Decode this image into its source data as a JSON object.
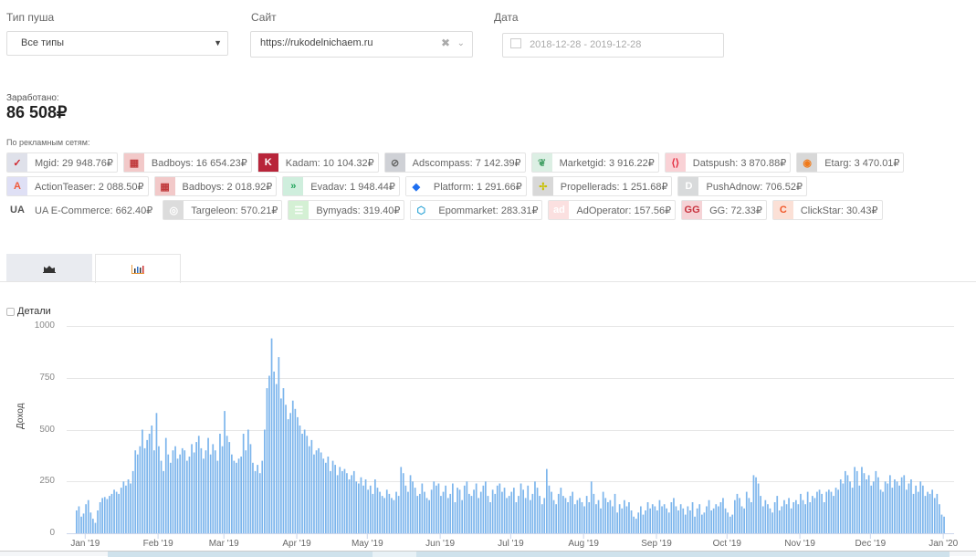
{
  "filters": {
    "push_type": {
      "label": "Тип пуша",
      "value": "Все типы"
    },
    "site": {
      "label": "Сайт",
      "value": "https://rukodelnichaem.ru"
    },
    "date": {
      "label": "Дата",
      "value": "2018-12-28 - 2019-12-28"
    }
  },
  "earned": {
    "label": "Заработано:",
    "value": "86 508₽"
  },
  "networks_label": "По рекламным сетям:",
  "networks": [
    {
      "name": "Mgid: 29 948.76₽",
      "icon": "✓",
      "bg": "#dfe1ea",
      "fg": "#d0262e"
    },
    {
      "name": "Badboys: 16 654.23₽",
      "icon": "▦",
      "bg": "#f2c9c9",
      "fg": "#c0393b"
    },
    {
      "name": "Kadam: 10 104.32₽",
      "icon": "K",
      "bg": "#b8253a",
      "fg": "#fff"
    },
    {
      "name": "Adscompass: 7 142.39₽",
      "icon": "⊘",
      "bg": "#cfd1d6",
      "fg": "#666"
    },
    {
      "name": "Marketgid: 3 916.22₽",
      "icon": "❦",
      "bg": "#dcefe4",
      "fg": "#4aa36b"
    },
    {
      "name": "Datspush: 3 870.88₽",
      "icon": "⟨⟩",
      "bg": "#f9d2d6",
      "fg": "#e3273b"
    },
    {
      "name": "Etarg: 3 470.01₽",
      "icon": "◉",
      "bg": "#d8d8d8",
      "fg": "#f07a1a"
    },
    {
      "name": "ActionTeaser: 2 088.50₽",
      "icon": "A",
      "bg": "#dfe0f5",
      "fg": "#f05a3a"
    },
    {
      "name": "Badboys: 2 018.92₽",
      "icon": "▦",
      "bg": "#f2c9c9",
      "fg": "#c0393b"
    },
    {
      "name": "Evadav: 1 948.44₽",
      "icon": "»",
      "bg": "#cfeedd",
      "fg": "#1fa35a"
    },
    {
      "name": "Platform: 1 291.66₽",
      "icon": "◆",
      "bg": "#fff",
      "fg": "#1e6ff0"
    },
    {
      "name": "Propellerads: 1 251.68₽",
      "icon": "✢",
      "bg": "#d8d8d8",
      "fg": "#c8c000"
    },
    {
      "name": "PushAdnow: 706.52₽",
      "icon": "D",
      "bg": "#d8dadb",
      "fg": "#fff"
    },
    {
      "name": "UA E-Commerce: 662.40₽",
      "icon": "UA",
      "bg": "#fff",
      "fg": "#555"
    },
    {
      "name": "Targeleon: 570.21₽",
      "icon": "◎",
      "bg": "#dcdcdc",
      "fg": "#fff"
    },
    {
      "name": "Bymyads: 319.40₽",
      "icon": "☰",
      "bg": "#d4f0d4",
      "fg": "#fff"
    },
    {
      "name": "Epommarket: 283.31₽",
      "icon": "⬡",
      "bg": "#fff",
      "fg": "#2aa3d6"
    },
    {
      "name": "AdOperator: 157.56₽",
      "icon": "ad",
      "bg": "#fbe0e0",
      "fg": "#fff"
    },
    {
      "name": "GG: 72.33₽",
      "icon": "GG",
      "bg": "#f5d3d6",
      "fg": "#c8343f"
    },
    {
      "name": "ClickStar: 30.43₽",
      "icon": "C",
      "bg": "#fbe0d6",
      "fg": "#f0582a"
    }
  ],
  "tabs": [
    {
      "name": "area-chart-tab",
      "icon": "area-chart-icon"
    },
    {
      "name": "bar-chart-tab",
      "icon": "bar-chart-icon"
    }
  ],
  "details_label": "Детали",
  "chart_data": {
    "type": "bar",
    "start_date": "2018-12-28",
    "ylabel": "Доход",
    "ylim": [
      0,
      1000
    ],
    "yticks": [
      "0",
      "250",
      "500",
      "750",
      "1000"
    ],
    "xticks": [
      "Jan '19",
      "Feb '19",
      "Mar '19",
      "Apr '19",
      "May '19",
      "Jun '19",
      "Jul '19",
      "Aug '19",
      "Sep '19",
      "Oct '19",
      "Nov '19",
      "Dec '19",
      "Jan '20"
    ],
    "xtick_days": [
      4,
      35,
      63,
      94,
      124,
      155,
      185,
      216,
      247,
      277,
      308,
      338,
      369
    ],
    "color": "#7cb5ec",
    "values": [
      110,
      130,
      80,
      95,
      140,
      160,
      100,
      70,
      50,
      110,
      150,
      170,
      175,
      165,
      180,
      190,
      210,
      200,
      190,
      220,
      250,
      230,
      260,
      240,
      300,
      400,
      380,
      420,
      500,
      410,
      450,
      480,
      520,
      400,
      580,
      420,
      350,
      300,
      460,
      380,
      340,
      400,
      420,
      360,
      380,
      410,
      400,
      350,
      370,
      430,
      390,
      440,
      470,
      410,
      360,
      400,
      460,
      380,
      430,
      400,
      350,
      480,
      420,
      590,
      470,
      440,
      380,
      350,
      340,
      360,
      370,
      480,
      400,
      500,
      430,
      340,
      300,
      330,
      290,
      350,
      500,
      700,
      760,
      940,
      780,
      720,
      850,
      650,
      700,
      620,
      550,
      580,
      640,
      600,
      560,
      520,
      480,
      500,
      470,
      420,
      450,
      380,
      400,
      410,
      390,
      360,
      340,
      370,
      300,
      350,
      330,
      280,
      320,
      300,
      310,
      290,
      260,
      280,
      300,
      250,
      240,
      270,
      230,
      260,
      210,
      230,
      190,
      260,
      220,
      200,
      180,
      170,
      210,
      190,
      170,
      160,
      200,
      180,
      320,
      290,
      230,
      200,
      280,
      250,
      220,
      180,
      190,
      240,
      200,
      170,
      160,
      210,
      250,
      230,
      240,
      180,
      200,
      230,
      170,
      190,
      240,
      150,
      220,
      210,
      160,
      230,
      250,
      190,
      180,
      210,
      240,
      170,
      200,
      230,
      250,
      180,
      150,
      210,
      190,
      230,
      240,
      200,
      220,
      170,
      180,
      200,
      220,
      150,
      180,
      240,
      210,
      170,
      230,
      160,
      190,
      250,
      220,
      180,
      140,
      170,
      310,
      230,
      200,
      160,
      140,
      190,
      220,
      180,
      170,
      150,
      180,
      200,
      140,
      160,
      170,
      150,
      130,
      180,
      150,
      250,
      190,
      140,
      160,
      120,
      200,
      170,
      150,
      160,
      130,
      190,
      100,
      140,
      120,
      160,
      130,
      150,
      110,
      80,
      70,
      100,
      130,
      90,
      110,
      150,
      120,
      140,
      130,
      110,
      160,
      130,
      140,
      120,
      100,
      150,
      170,
      130,
      110,
      140,
      120,
      90,
      130,
      110,
      150,
      80,
      120,
      140,
      90,
      100,
      130,
      160,
      110,
      120,
      140,
      130,
      150,
      170,
      120,
      100,
      80,
      90,
      160,
      190,
      170,
      130,
      120,
      200,
      170,
      150,
      280,
      270,
      240,
      180,
      130,
      160,
      140,
      120,
      100,
      150,
      180,
      110,
      130,
      160,
      140,
      170,
      120,
      150,
      160,
      140,
      190,
      160,
      140,
      200,
      150,
      180,
      170,
      200,
      210,
      190,
      150,
      200,
      210,
      200,
      180,
      220,
      210,
      260,
      240,
      300,
      280,
      250,
      220,
      320,
      300,
      230,
      320,
      290,
      260,
      280,
      230,
      250,
      300,
      270,
      210,
      200,
      250,
      240,
      280,
      220,
      260,
      250,
      230,
      270,
      280,
      210,
      240,
      260,
      190,
      230,
      200,
      250,
      230,
      180,
      200,
      190,
      210,
      170,
      190,
      140,
      90,
      80
    ]
  }
}
